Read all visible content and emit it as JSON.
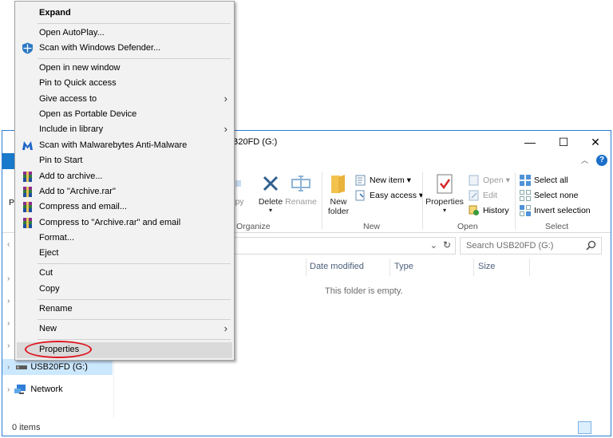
{
  "window": {
    "title": "USB20FD (G:)",
    "title_visible": "B20FD (G:)",
    "minimize_glyph": "—",
    "maximize_glyph": "☐",
    "close_glyph": "✕"
  },
  "ribbon": {
    "groups": {
      "organize": "Organize",
      "new": "New",
      "open": "Open",
      "select": "Select"
    },
    "buttons": {
      "copy_fragment": "py",
      "delete": "Delete",
      "rename": "Rename",
      "new_folder_line1": "New",
      "new_folder_line2": "folder",
      "new_item": "New item ▾",
      "easy_access": "Easy access ▾",
      "properties": "Properties",
      "properties_arrow": "▾",
      "open": "Open ▾",
      "edit": "Edit",
      "history": "History",
      "select_all": "Select all",
      "select_none": "Select none",
      "invert_selection": "Invert selection"
    },
    "left_fragment": "Pi"
  },
  "address": {
    "search_placeholder": "Search USB20FD (G:)"
  },
  "columns": [
    "Date modified",
    "Type",
    "Size"
  ],
  "empty_message": "This folder is empty.",
  "nav": {
    "usb_label": "USB20FD (G:)",
    "network_label": "Network"
  },
  "status": {
    "items": "0 items"
  },
  "context_menu": {
    "items": [
      {
        "label": "Expand"
      },
      {
        "label": "Open AutoPlay..."
      },
      {
        "label": "Scan with Windows Defender..."
      },
      {
        "label": "Open in new window"
      },
      {
        "label": "Pin to Quick access"
      },
      {
        "label": "Give access to"
      },
      {
        "label": "Open as Portable Device"
      },
      {
        "label": "Include in library"
      },
      {
        "label": "Scan with Malwarebytes Anti-Malware"
      },
      {
        "label": "Pin to Start"
      },
      {
        "label": "Add to archive..."
      },
      {
        "label": "Add to \"Archive.rar\""
      },
      {
        "label": "Compress and email..."
      },
      {
        "label": "Compress to \"Archive.rar\" and email"
      },
      {
        "label": "Format..."
      },
      {
        "label": "Eject"
      },
      {
        "label": "Cut"
      },
      {
        "label": "Copy"
      },
      {
        "label": "Rename"
      },
      {
        "label": "New"
      },
      {
        "label": "Properties"
      }
    ],
    "submenu_glyph": "›"
  },
  "colors": {
    "accent": "#1979ca",
    "selection": "#cce8ff",
    "menu_bg": "#f2f2f2",
    "highlight_circle": "#e0141e"
  }
}
